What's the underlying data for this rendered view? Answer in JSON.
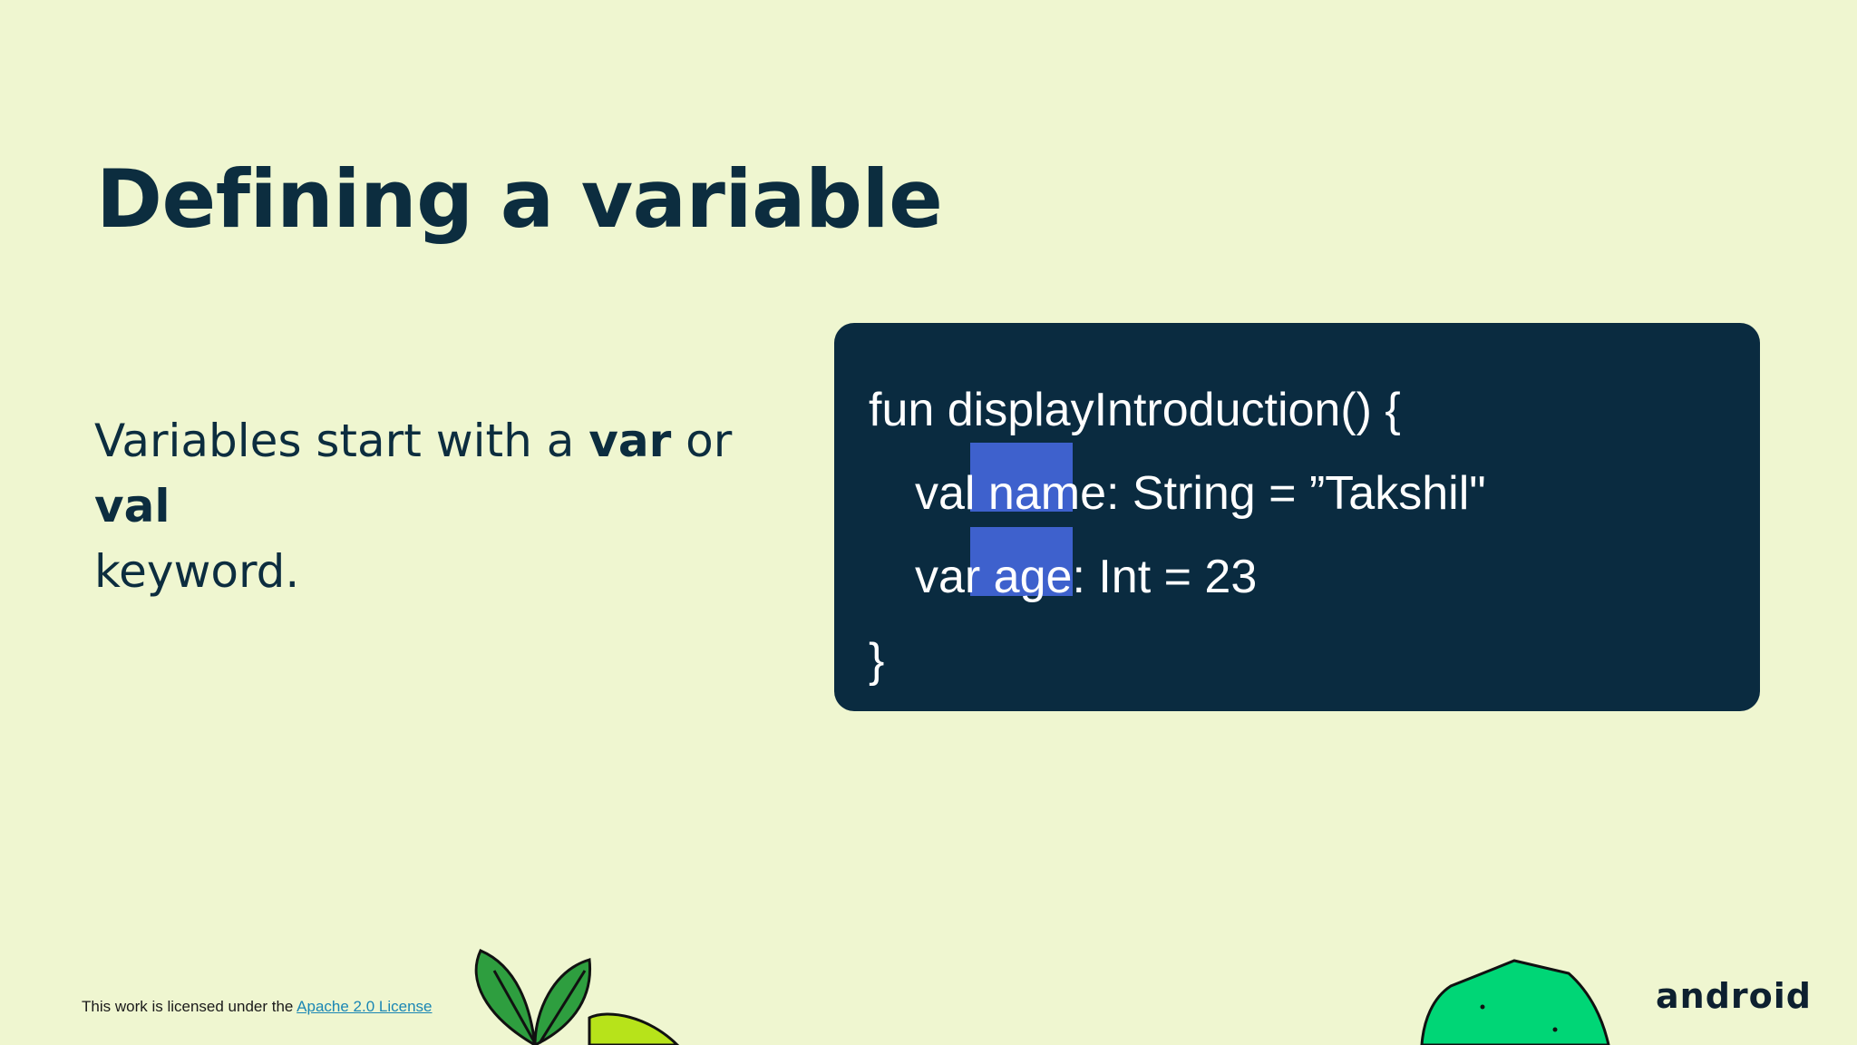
{
  "slide": {
    "title": "Defining a variable",
    "body": {
      "part1": "Variables start with a ",
      "kw1": "var",
      "part2": " or ",
      "kw2": "val",
      "part3": "keyword."
    }
  },
  "code": {
    "line1": "fun displayIntroduction() {",
    "line2": "val name: String = ”Takshil\"",
    "line3": "var age: Int = 23",
    "line4": "}"
  },
  "footer": {
    "license_prefix": "This work is licensed under the ",
    "license_link": "Apache 2.0 License",
    "logo": "android"
  },
  "colors": {
    "background": "#eff6d0",
    "title": "#0c2d3f",
    "code_bg": "#0a2b40",
    "highlight": "#3e61cd",
    "link": "#1a86b4"
  }
}
